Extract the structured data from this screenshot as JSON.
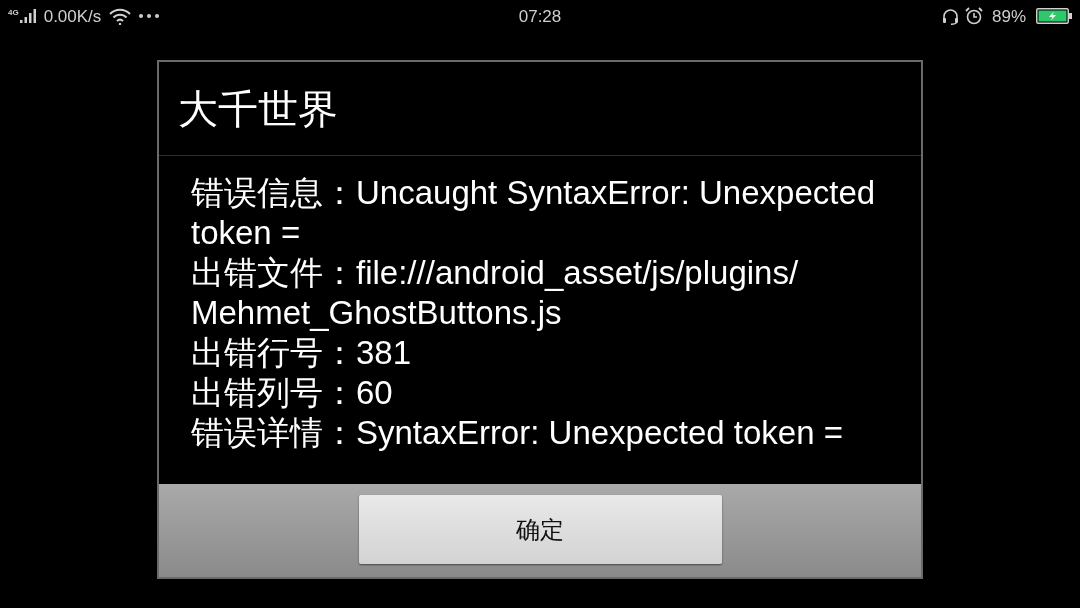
{
  "status_bar": {
    "network_type": "4G",
    "network_speed": "0.00K/s",
    "time": "07:28",
    "battery": "89%"
  },
  "dialog": {
    "title": "大千世界",
    "lines": [
      {
        "label": "错误信息：",
        "value": "Uncaught SyntaxError: Unexpected token ="
      },
      {
        "label": "出错文件：",
        "value": "file:///android_asset/js/plugins/Mehmet_GhostButtons.js"
      },
      {
        "label": "出错行号：",
        "value": "381"
      },
      {
        "label": "出错列号：",
        "value": "60"
      },
      {
        "label": "错误详情：",
        "value": "SyntaxError: Unexpected token ="
      }
    ],
    "buttons": [
      "确定"
    ]
  }
}
